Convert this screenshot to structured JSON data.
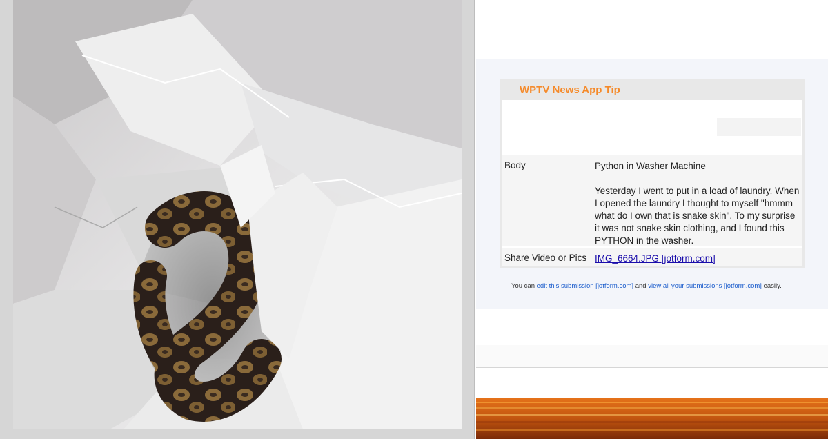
{
  "viewer": {
    "image_alt": "Python snake coiled in white plastic inside washer"
  },
  "email": {
    "title": "WPTV News App Tip",
    "rows": [
      {
        "label": "Body",
        "subject": "Python in Washer Machine",
        "text": "Yesterday I went to put in a load of laundry. When I opened the laundry I thought to myself \"hmmm what do I own that is snake skin\". To my surprise it was not snake skin clothing, and I found this PYTHON in the washer."
      },
      {
        "label": "Share Video or Pics",
        "link": "IMG_6664.JPG [jotform.com]"
      }
    ],
    "footer": {
      "prefix": "You can ",
      "edit_link": "edit this submission [jotform.com]",
      "middle": " and ",
      "view_link": "view all your submissions [jotform.com]",
      "suffix": " easily."
    },
    "colors": {
      "title": "#f58a2a",
      "link": "#1a0dab"
    }
  }
}
